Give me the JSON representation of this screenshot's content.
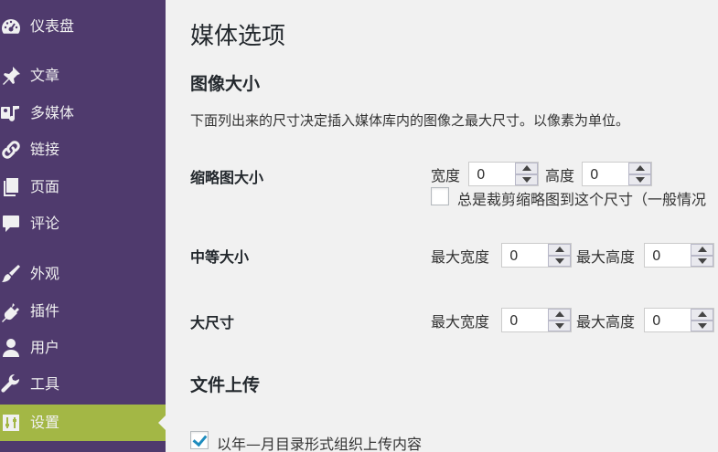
{
  "sidebar": {
    "items": [
      {
        "label": "仪表盘",
        "icon": "dashboard-icon"
      },
      {
        "label": "文章",
        "icon": "pin-icon"
      },
      {
        "label": "多媒体",
        "icon": "media-icon"
      },
      {
        "label": "链接",
        "icon": "link-icon"
      },
      {
        "label": "页面",
        "icon": "pages-icon"
      },
      {
        "label": "评论",
        "icon": "comment-icon"
      },
      {
        "label": "外观",
        "icon": "brush-icon"
      },
      {
        "label": "插件",
        "icon": "plugin-icon"
      },
      {
        "label": "用户",
        "icon": "user-icon"
      },
      {
        "label": "工具",
        "icon": "wrench-icon"
      },
      {
        "label": "设置",
        "icon": "settings-icon",
        "active": true
      }
    ],
    "colors": {
      "background": "#4f3a6d",
      "active": "#a3b745"
    }
  },
  "main": {
    "title": "媒体选项",
    "image_sizes": {
      "heading": "图像大小",
      "description": "下面列出来的尺寸决定插入媒体库内的图像之最大尺寸。以像素为单位。",
      "thumbnail": {
        "label": "缩略图大小",
        "width_label": "宽度",
        "width_value": "0",
        "height_label": "高度",
        "height_value": "0",
        "crop_label": "总是裁剪缩略图到这个尺寸（一般情况",
        "crop_checked": false
      },
      "medium": {
        "label": "中等大小",
        "width_label": "最大宽度",
        "width_value": "0",
        "height_label": "最大高度",
        "height_value": "0"
      },
      "large": {
        "label": "大尺寸",
        "width_label": "最大宽度",
        "width_value": "0",
        "height_label": "最大高度",
        "height_value": "0"
      }
    },
    "uploads": {
      "heading": "文件上传",
      "organize_label": "以年—月目录形式组织上传内容",
      "organize_checked": true
    }
  }
}
